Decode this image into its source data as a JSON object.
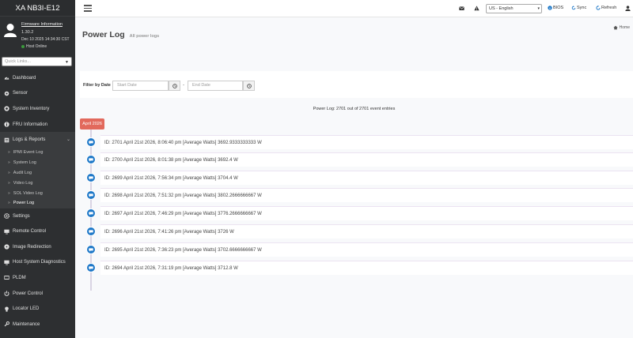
{
  "sidebar": {
    "brand": "XA NB3I-E12",
    "firmware_link": "Firmware Information",
    "firmware_version": "1.30.2",
    "firmware_date": "Dec 10 2025 14:34:30 CST",
    "host_status": "Host Online",
    "quick_links_placeholder": "Quick Links...",
    "menu": [
      {
        "label": "Dashboard",
        "icon": "dashboard-icon"
      },
      {
        "label": "Sensor",
        "icon": "sensor-icon"
      },
      {
        "label": "System Inventory",
        "icon": "inventory-icon"
      },
      {
        "label": "FRU Information",
        "icon": "info-icon"
      },
      {
        "label": "Logs & Reports",
        "icon": "logs-icon"
      }
    ],
    "submenu": [
      "IPMI Event Log",
      "System Log",
      "Audit Log",
      "Video Log",
      "SOL Video Log",
      "Power Log"
    ],
    "menu_after": [
      {
        "label": "Settings",
        "icon": "settings-icon"
      },
      {
        "label": "Remote Control",
        "icon": "monitor-icon"
      },
      {
        "label": "Image Redirection",
        "icon": "disc-icon"
      },
      {
        "label": "Host System Diagnostics",
        "icon": "diagnostics-icon"
      },
      {
        "label": "PLDM",
        "icon": "pldm-icon"
      },
      {
        "label": "Power Control",
        "icon": "power-icon"
      },
      {
        "label": "Locator LED",
        "icon": "bulb-icon"
      },
      {
        "label": "Maintenance",
        "icon": "wrench-icon"
      }
    ]
  },
  "header": {
    "language": "US - English",
    "bios_label": "BIOS",
    "sync_label": "Sync",
    "refresh_label": "Refresh"
  },
  "page": {
    "title": "Power Log",
    "subtitle": "All power logs",
    "breadcrumb_home": "Home"
  },
  "filter": {
    "label": "Filter by Date",
    "start_placeholder": "Start Date",
    "end_placeholder": "End Date",
    "separator": "-"
  },
  "summary": "Power Log: 2701 out of 2701 event entries",
  "timeline": {
    "month_badge": "April 2026",
    "entries": [
      "ID: 2701 April 21st 2026, 8:06:40 pm [Average Watts] 3692.9333333333 W",
      "ID: 2700 April 21st 2026, 8:01:38 pm [Average Watts] 3692.4 W",
      "ID: 2699 April 21st 2026, 7:56:34 pm [Average Watts] 3704.4 W",
      "ID: 2698 April 21st 2026, 7:51:32 pm [Average Watts] 3802.2666666667 W",
      "ID: 2697 April 21st 2026, 7:46:29 pm [Average Watts] 3776.2666666667 W",
      "ID: 2696 April 21st 2026, 7:41:26 pm [Average Watts] 3726 W",
      "ID: 2695 April 21st 2026, 7:36:23 pm [Average Watts] 3702.6666666667 W",
      "ID: 2694 April 21st 2026, 7:31:19 pm [Average Watts] 3712.8 W"
    ]
  },
  "colors": {
    "sidebar_bg": "#2d2f31",
    "badge": "#e2695c",
    "timeline_icon": "#1e78c8",
    "online_dot": "#3c9a3c"
  }
}
